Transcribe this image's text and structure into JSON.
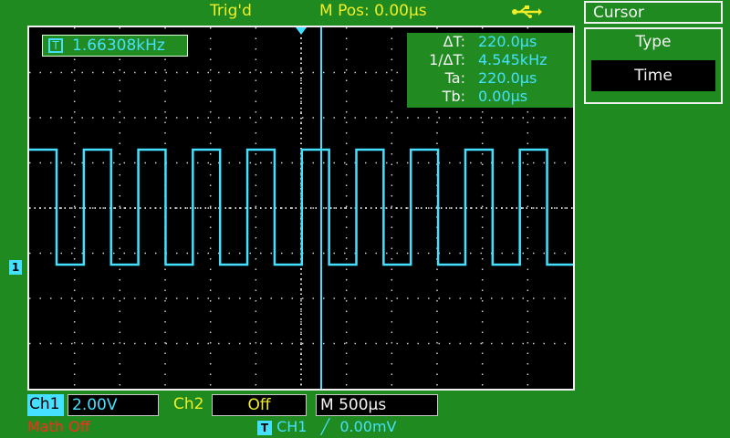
{
  "top_bar": {
    "trigger_status": "Trig'd",
    "horizontal_position": "M Pos: 0.00µs",
    "usb_icon": "usb-icon"
  },
  "measurement": {
    "frequency_badge": "T",
    "frequency": "1.66308kHz"
  },
  "cursor_readout": {
    "delta_t_label": "ΔT:",
    "delta_t": "220.0µs",
    "inv_delta_t_label": "1/ΔT:",
    "inv_delta_t": "4.545kHz",
    "ta_label": "Ta:",
    "ta": "220.0µs",
    "tb_label": "Tb:",
    "tb": "0.00µs"
  },
  "menu": {
    "title": "Cursor",
    "type_label": "Type",
    "type_value": "Time"
  },
  "channel_marker": "1",
  "bottom_bar": {
    "ch1_label": "Ch1",
    "ch1_scale": "2.00V",
    "ch2_label": "Ch2",
    "ch2_state": "Off",
    "timebase_prefix": "M",
    "timebase": "500µs",
    "math": "Math Off",
    "trigger_badge": "T",
    "trigger_source": "CH1",
    "trigger_slope": "╱",
    "trigger_level": "0.00mV"
  },
  "colors": {
    "background": "#1f8a1f",
    "trace": "#45e0ff",
    "accent_yellow": "#f1ee28",
    "math_red": "#ff2a1a"
  },
  "waveform": {
    "type": "square",
    "frequency_khz": 1.66308,
    "volts_per_div": 2.0,
    "time_per_div_us": 500
  }
}
